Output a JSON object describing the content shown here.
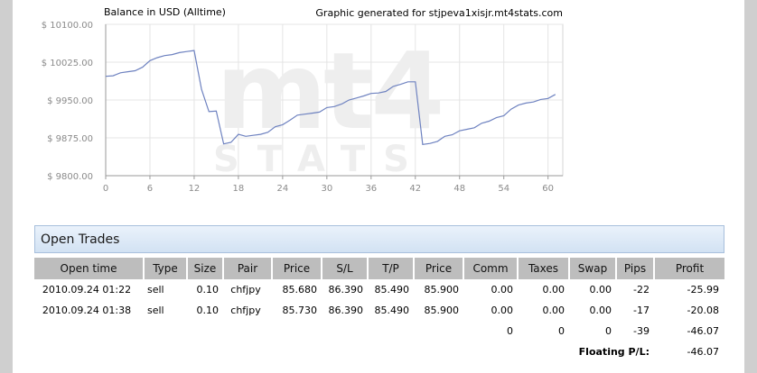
{
  "chart_data": {
    "type": "line",
    "title": "Balance in USD (Alltime)",
    "credit": "Graphic generated for stjpeva1xisjr.mt4stats.com",
    "xlabel": "",
    "ylabel": "",
    "xlim": [
      0,
      62
    ],
    "ylim": [
      9800,
      10100
    ],
    "x_ticks": [
      "0",
      "6",
      "12",
      "18",
      "24",
      "30",
      "36",
      "42",
      "48",
      "54",
      "60"
    ],
    "y_ticks": [
      "$ 10100.00",
      "$ 10025.00",
      "$ 9950.00",
      "$ 9875.00",
      "$ 9800.00"
    ],
    "grid": true,
    "series_color": "#6e82c0",
    "series": [
      {
        "x": [
          0,
          1,
          2,
          3,
          4,
          5,
          6,
          7,
          8,
          9,
          10,
          11,
          12,
          13,
          14,
          15,
          16,
          17,
          18,
          19,
          20,
          21,
          22,
          23,
          24,
          25,
          26,
          27,
          28,
          29,
          30,
          31,
          32,
          33,
          34,
          35,
          36,
          37,
          38,
          39,
          40,
          41,
          42,
          43,
          44,
          45,
          46,
          47,
          48,
          49,
          50,
          51,
          52,
          53,
          54,
          55,
          56,
          57,
          58,
          59,
          60,
          61
        ],
        "y": [
          9997,
          9998,
          10004,
          10006,
          10008,
          10015,
          10028,
          10034,
          10038,
          10040,
          10044,
          10046,
          10048,
          9971,
          9927,
          9928,
          9863,
          9866,
          9882,
          9878,
          9880,
          9882,
          9886,
          9897,
          9901,
          9910,
          9920,
          9922,
          9924,
          9926,
          9935,
          9937,
          9942,
          9950,
          9954,
          9958,
          9963,
          9964,
          9967,
          9977,
          9981,
          9986,
          9986,
          9862,
          9864,
          9868,
          9878,
          9881,
          9889,
          9892,
          9895,
          9904,
          9908,
          9915,
          9919,
          9932,
          9940,
          9944,
          9946,
          9951,
          9953,
          9961
        ]
      }
    ]
  },
  "watermark": {
    "logo": "mt4",
    "sub": "STATS"
  },
  "trades": {
    "title": "Open Trades",
    "headers": [
      "Open time",
      "Type",
      "Size",
      "Pair",
      "Price",
      "S/L",
      "T/P",
      "Price",
      "Comm",
      "Taxes",
      "Swap",
      "Pips",
      "Profit"
    ],
    "rows": [
      [
        "2010.09.24 01:22",
        "sell",
        "0.10",
        "chfjpy",
        "85.680",
        "86.390",
        "85.490",
        "85.900",
        "0.00",
        "0.00",
        "0.00",
        "-22",
        "-25.99"
      ],
      [
        "2010.09.24 01:38",
        "sell",
        "0.10",
        "chfjpy",
        "85.730",
        "86.390",
        "85.490",
        "85.900",
        "0.00",
        "0.00",
        "0.00",
        "-17",
        "-20.08"
      ]
    ],
    "totals": {
      "comm": "0",
      "taxes": "0",
      "swap": "0",
      "pips": "-39",
      "profit": "-46.07"
    },
    "floating_label": "Floating P/L:",
    "floating_value": "-46.07"
  }
}
